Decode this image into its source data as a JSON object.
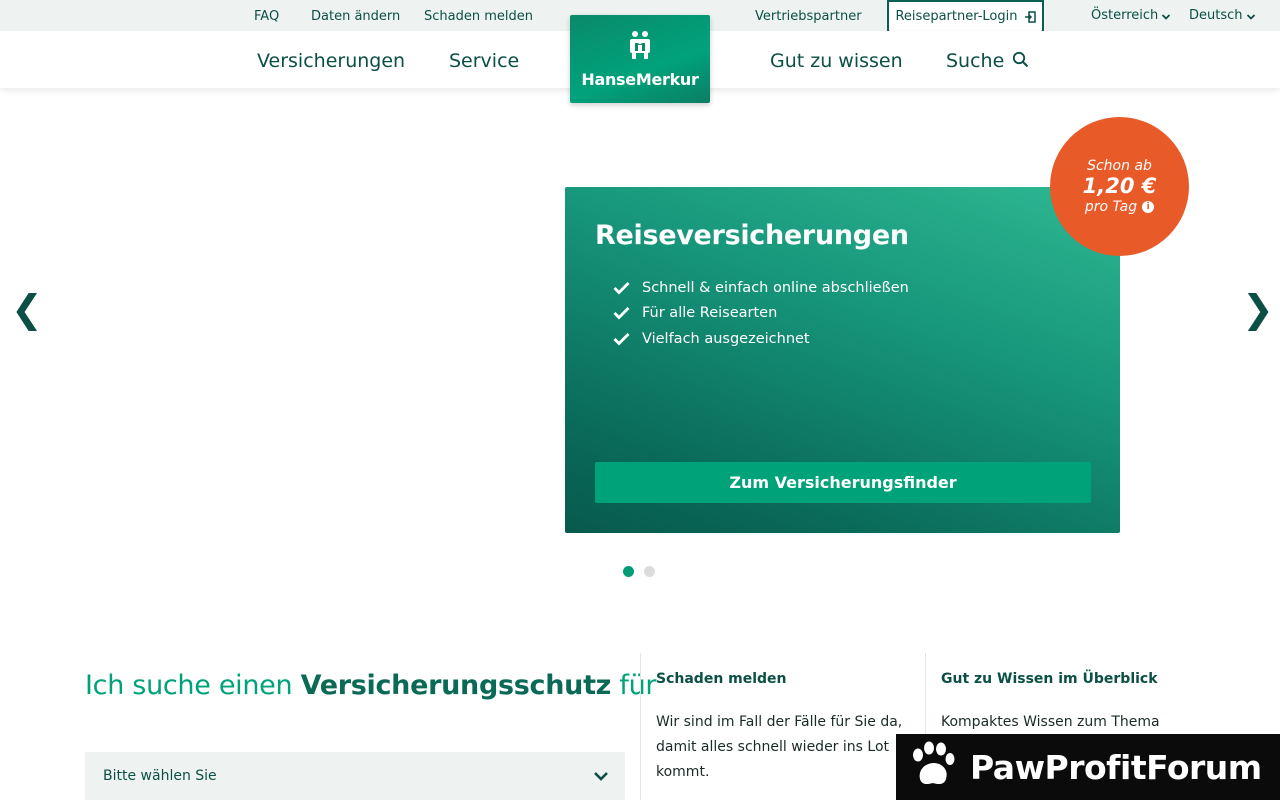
{
  "topbar": {
    "faq": "FAQ",
    "change_data": "Daten ändern",
    "report_claim": "Schaden melden",
    "sales_partner": "Vertriebspartner",
    "login": "Reisepartner-Login",
    "country": "Österreich",
    "language": "Deutsch"
  },
  "nav": {
    "insurance": "Versicherungen",
    "service": "Service",
    "good_to_know": "Gut zu wissen",
    "search": "Suche",
    "logo_text": "HanseMerkur"
  },
  "hero": {
    "title": "Reiseversicherungen",
    "features": [
      "Schnell & einfach online abschließen",
      "Für alle Reisearten",
      "Vielfach ausgezeichnet"
    ],
    "cta": "Zum Versicherungsfinder",
    "price_line1": "Schon ab",
    "price_line2": "1,20 €",
    "price_line3": "pro Tag",
    "info_glyph": "i",
    "prev_glyph": "❮",
    "next_glyph": "❯",
    "active_slide": 1,
    "slide_count": 2
  },
  "finder": {
    "heading_pre": "Ich suche einen ",
    "heading_bold": "Versicherungsschutz",
    "heading_post": " für",
    "select_value": "Bitte wählen Sie"
  },
  "claims": {
    "title": "Schaden melden",
    "text": "Wir sind im Fall der Fälle für Sie da, damit alles schnell wieder ins Lot kommt."
  },
  "knowledge": {
    "title": "Gut zu Wissen im Überblick",
    "text": "Kompaktes Wissen zum Thema"
  },
  "watermark": {
    "text": "PawProfitForum"
  },
  "colors": {
    "brand_dark": "#0b4f45",
    "brand_green": "#00a27a",
    "badge_orange": "#e85a28"
  }
}
